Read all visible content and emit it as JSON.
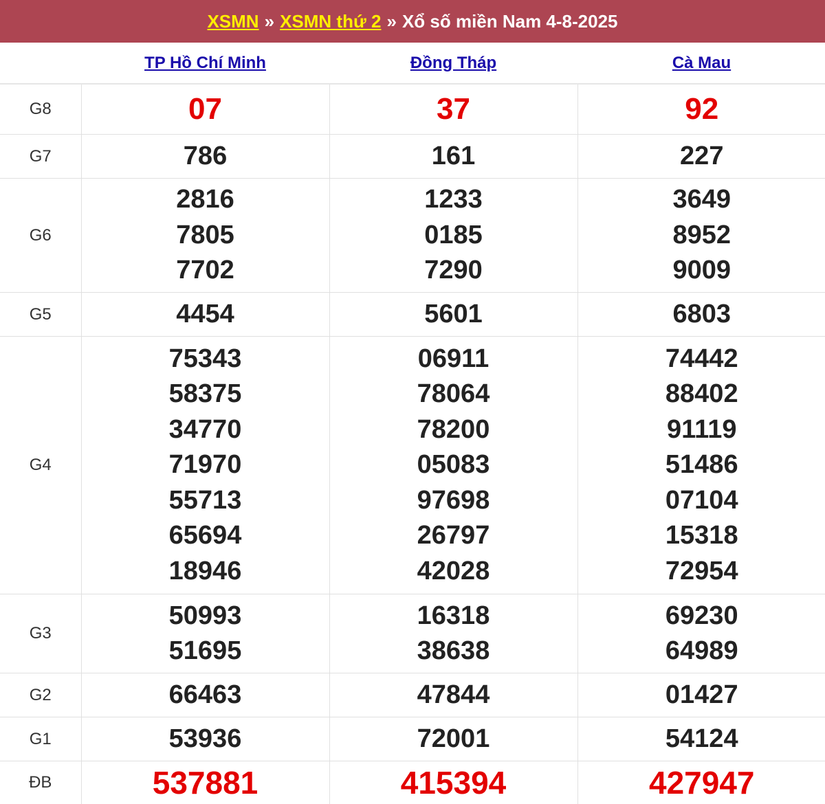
{
  "header": {
    "link1": "XSMN",
    "sep1": "»",
    "link2": "XSMN thứ 2",
    "sep2": "»",
    "title": "Xổ số miền Nam 4-8-2025"
  },
  "provinces": [
    "TP Hồ Chí Minh",
    "Đồng Tháp",
    "Cà Mau"
  ],
  "prizes": {
    "g8": {
      "label": "G8",
      "values": [
        [
          "07"
        ],
        [
          "37"
        ],
        [
          "92"
        ]
      ]
    },
    "g7": {
      "label": "G7",
      "values": [
        [
          "786"
        ],
        [
          "161"
        ],
        [
          "227"
        ]
      ]
    },
    "g6": {
      "label": "G6",
      "values": [
        [
          "2816",
          "7805",
          "7702"
        ],
        [
          "1233",
          "0185",
          "7290"
        ],
        [
          "3649",
          "8952",
          "9009"
        ]
      ]
    },
    "g5": {
      "label": "G5",
      "values": [
        [
          "4454"
        ],
        [
          "5601"
        ],
        [
          "6803"
        ]
      ]
    },
    "g4": {
      "label": "G4",
      "values": [
        [
          "75343",
          "58375",
          "34770",
          "71970",
          "55713",
          "65694",
          "18946"
        ],
        [
          "06911",
          "78064",
          "78200",
          "05083",
          "97698",
          "26797",
          "42028"
        ],
        [
          "74442",
          "88402",
          "91119",
          "51486",
          "07104",
          "15318",
          "72954"
        ]
      ]
    },
    "g3": {
      "label": "G3",
      "values": [
        [
          "50993",
          "51695"
        ],
        [
          "16318",
          "38638"
        ],
        [
          "69230",
          "64989"
        ]
      ]
    },
    "g2": {
      "label": "G2",
      "values": [
        [
          "66463"
        ],
        [
          "47844"
        ],
        [
          "01427"
        ]
      ]
    },
    "g1": {
      "label": "G1",
      "values": [
        [
          "53936"
        ],
        [
          "72001"
        ],
        [
          "54124"
        ]
      ]
    },
    "db": {
      "label": "ĐB",
      "values": [
        [
          "537881"
        ],
        [
          "415394"
        ],
        [
          "427947"
        ]
      ]
    }
  },
  "colors": {
    "header_bg": "#ad4552",
    "header_link": "#ffee00",
    "highlight": "#e30000",
    "province_link": "#1a0dab"
  }
}
